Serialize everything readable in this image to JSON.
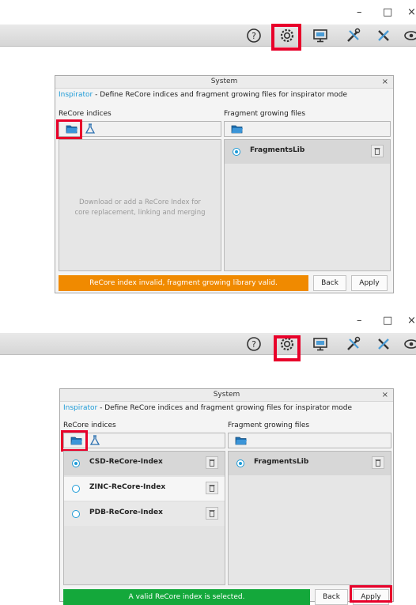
{
  "colors": {
    "accent": "#1e9bd7",
    "highlight": "#e8002a",
    "status_invalid": "#f08a00",
    "status_valid": "#14a83b"
  },
  "window_controls": {
    "minimize": "–",
    "maximize": "□",
    "close": "×"
  },
  "toolbar_icons": [
    "help-icon",
    "settings-gear-icon",
    "monitor-icon",
    "tools-icon",
    "cross-tools-icon",
    "visibility-icon"
  ],
  "screens": [
    {
      "dialog": {
        "title": "System",
        "close": "×",
        "mode": "Inspirator",
        "description": " - Define ReCore indices and fragment growing files for inspirator mode",
        "recore_label": "ReCore indices",
        "fragment_label": "Fragment growing files",
        "placeholder_line1": "Download or add a ReCore Index for",
        "placeholder_line2": "core replacement, linking and merging",
        "fragments": [
          {
            "name": "FragmentsLib",
            "selected": true
          }
        ],
        "status": "ReCore index invalid, fragment growing library valid.",
        "status_color": "orange",
        "back": "Back",
        "apply": "Apply"
      }
    },
    {
      "dialog": {
        "title": "System",
        "close": "×",
        "mode": "Inspirator",
        "description": " - Define ReCore indices and fragment growing files for inspirator mode",
        "recore_label": "ReCore indices",
        "fragment_label": "Fragment growing files",
        "indices": [
          {
            "name": "CSD-ReCore-Index",
            "selected": true
          },
          {
            "name": "ZINC-ReCore-Index",
            "selected": false
          },
          {
            "name": "PDB-ReCore-Index",
            "selected": false
          }
        ],
        "fragments": [
          {
            "name": "FragmentsLib",
            "selected": true
          }
        ],
        "status": "A valid ReCore index is selected.",
        "status_color": "green",
        "back": "Back",
        "apply": "Apply"
      }
    }
  ]
}
